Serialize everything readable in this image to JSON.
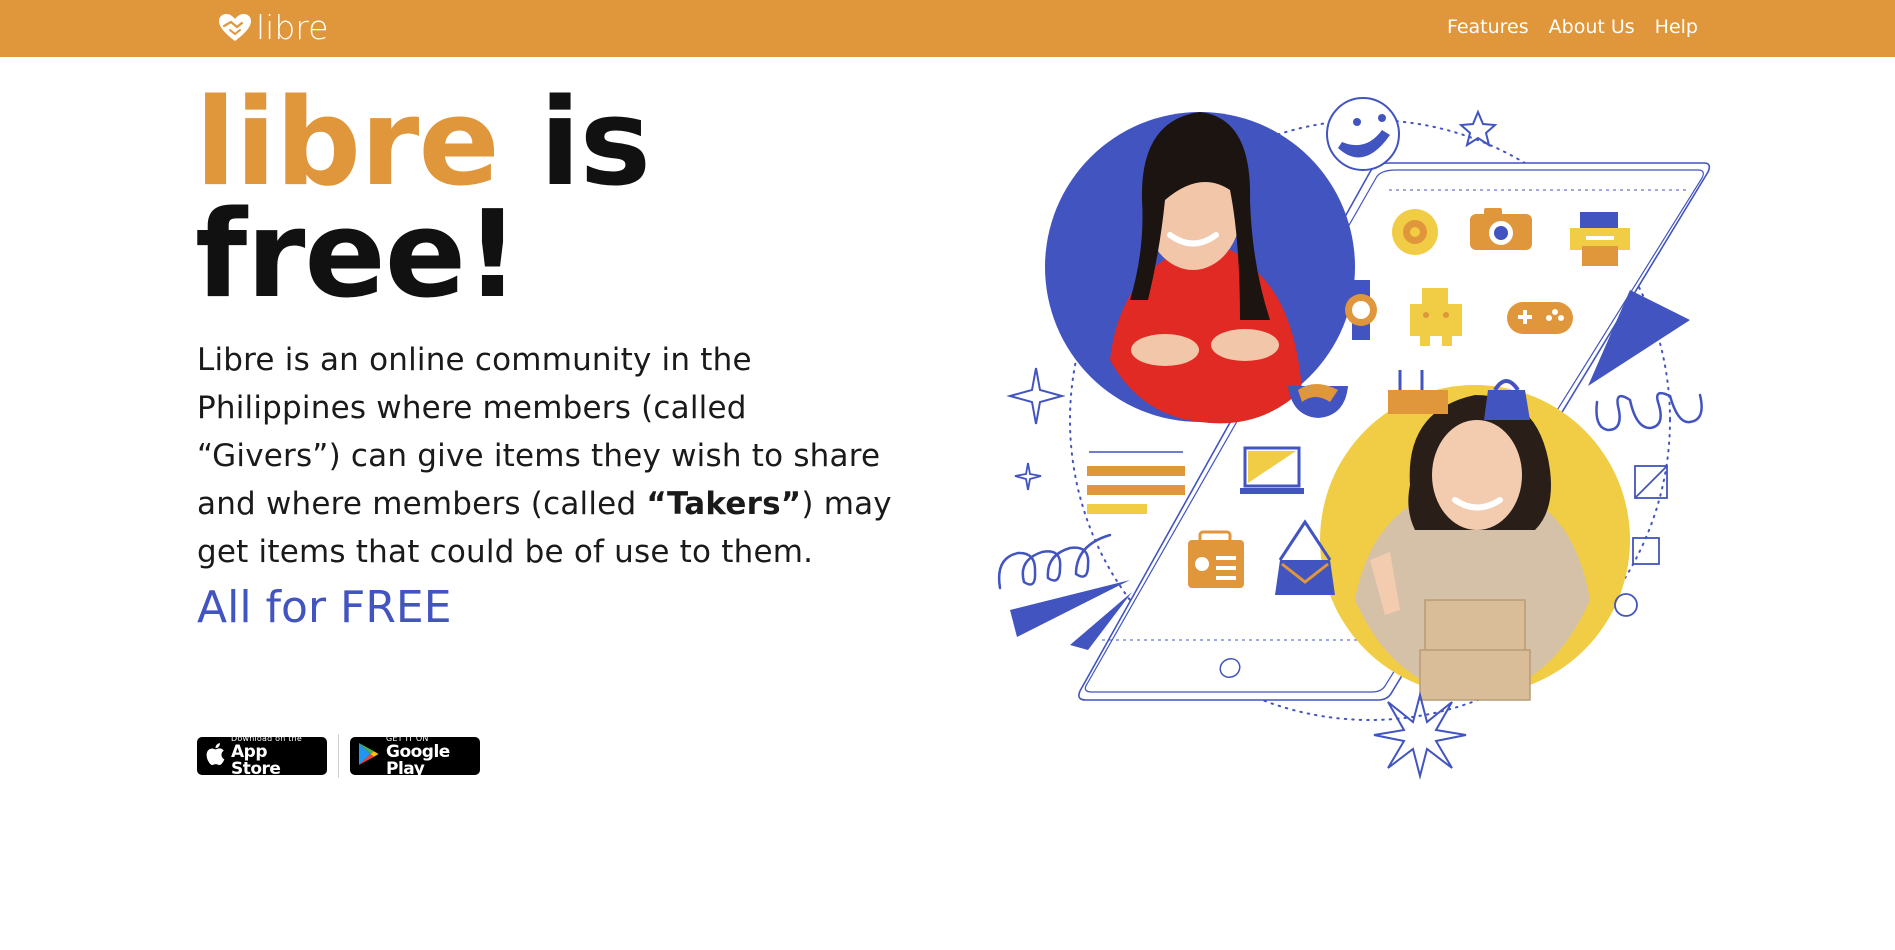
{
  "brand": {
    "name": "libre",
    "primary_color": "#e0963a",
    "accent_color": "#4254bf",
    "yellow_color": "#f0cd45"
  },
  "nav": {
    "logo_text": "libre",
    "links": [
      "Features",
      "About Us",
      "Help"
    ]
  },
  "hero": {
    "title_brand": "libre",
    "title_rest_1": " is",
    "title_rest_2": "free!",
    "description_1": "Libre is an online community in the Philippines where members (called “Givers”) can give items they wish to share and where members (called ",
    "description_bold": "“Takers”",
    "description_2": ") may get items that could be of use to them.",
    "tagline": "All for FREE"
  },
  "store_badges": {
    "appstore_small": "Download on the",
    "appstore_big": "App Store",
    "gplay_small": "GET IT ON",
    "gplay_big": "Google Play"
  },
  "illustration": {
    "icons": [
      "smiley-icon",
      "star-icon",
      "sparkle-icon",
      "coin-icon",
      "camera-icon",
      "printer-icon",
      "watch-icon",
      "robot-toy-icon",
      "gamepad-icon",
      "bowl-icon",
      "router-icon",
      "bag-icon",
      "monitor-icon",
      "radio-icon",
      "handbag-icon",
      "text-lines-icon"
    ]
  }
}
